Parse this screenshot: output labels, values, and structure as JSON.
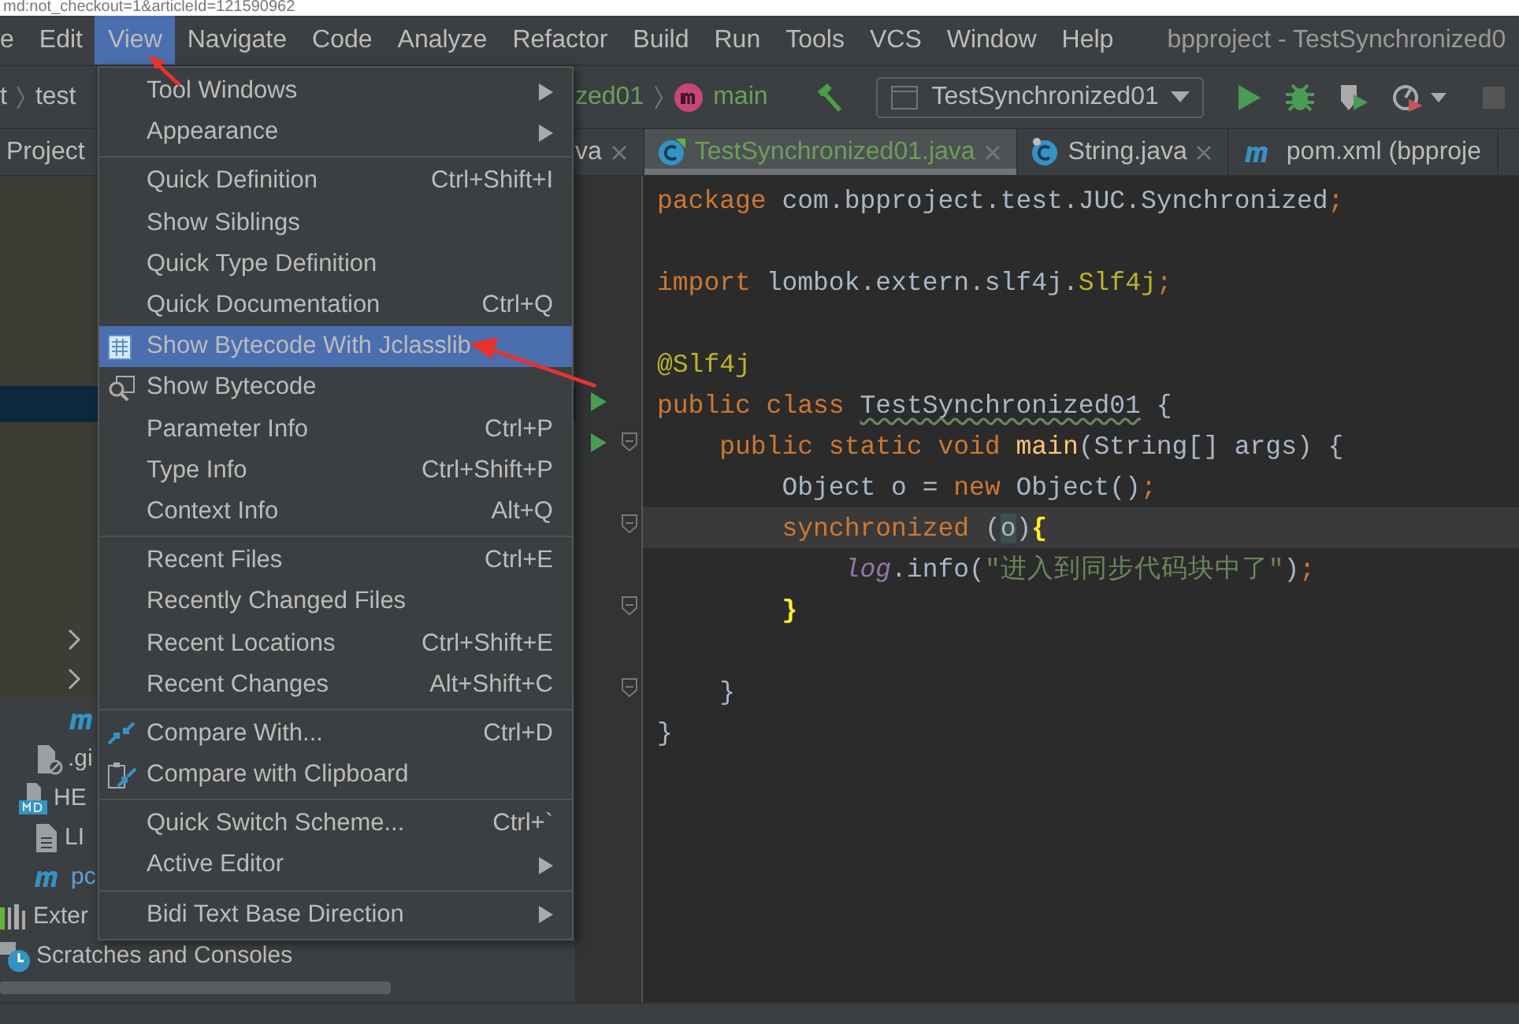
{
  "url_fragment": "md:not_checkout=1&articleId=121590962",
  "menu_bar": {
    "items": [
      {
        "label": "e",
        "selected": false
      },
      {
        "label": "Edit",
        "selected": false
      },
      {
        "label": "View",
        "selected": true
      },
      {
        "label": "Navigate",
        "selected": false
      },
      {
        "label": "Code",
        "selected": false
      },
      {
        "label": "Analyze",
        "selected": false
      },
      {
        "label": "Refactor",
        "selected": false
      },
      {
        "label": "Build",
        "selected": false
      },
      {
        "label": "Run",
        "selected": false
      },
      {
        "label": "Tools",
        "selected": false
      },
      {
        "label": "VCS",
        "selected": false
      },
      {
        "label": "Window",
        "selected": false
      },
      {
        "label": "Help",
        "selected": false
      }
    ],
    "window_title": "bpproject - TestSynchronized0"
  },
  "navigation_bar": {
    "project_crumbs": [
      "t",
      "test"
    ],
    "file_crumbs": [
      {
        "label": "zed01",
        "kind": "class"
      },
      {
        "label": "main",
        "kind": "method"
      }
    ],
    "run_configuration": "TestSynchronized01"
  },
  "project_panel": {
    "title": "Project",
    "tree_top": [
      {
        "kind": "blank",
        "selected": true
      },
      {
        "kind": "folder",
        "expanded": false,
        "selected": false
      },
      {
        "kind": "folder",
        "expanded": false,
        "selected": false
      }
    ],
    "tree_files": [
      {
        "kind": "maven"
      },
      {
        "kind": "ignored",
        "label": ".gi"
      },
      {
        "kind": "markdown",
        "label": "HE"
      },
      {
        "kind": "text",
        "label": "LI"
      },
      {
        "kind": "maven",
        "label": "pc"
      },
      {
        "kind": "library",
        "label": "Exter"
      },
      {
        "kind": "scratches",
        "label": "Scratches and Consoles"
      }
    ]
  },
  "editor_tabs": [
    {
      "label": "va",
      "kind": "plain",
      "selected": false
    },
    {
      "label": "TestSynchronized01.java",
      "kind": "class",
      "selected": true
    },
    {
      "label": "String.java",
      "kind": "locked",
      "selected": false
    },
    {
      "label": "pom.xml (bpproje",
      "kind": "maven",
      "selected": false
    }
  ],
  "code_lines": [
    {
      "current": false,
      "run_marker": false,
      "fold": false,
      "tokens": [
        {
          "kind": "keyword",
          "text": "package "
        },
        {
          "kind": "plain",
          "text": "com.bpproject.test.JUC.Synchronized"
        },
        {
          "kind": "keyword",
          "text": ";"
        }
      ]
    },
    {
      "current": false,
      "run_marker": false,
      "fold": false
    },
    {
      "current": false,
      "run_marker": false,
      "fold": false,
      "tokens": [
        {
          "kind": "keyword",
          "text": "import "
        },
        {
          "kind": "plain",
          "text": "lombok.extern.slf4j."
        },
        {
          "kind": "annotation",
          "text": "Slf4j"
        },
        {
          "kind": "keyword",
          "text": ";"
        }
      ]
    },
    {
      "current": false,
      "run_marker": false,
      "fold": false
    },
    {
      "current": false,
      "run_marker": false,
      "fold": false,
      "tokens": [
        {
          "kind": "annotation",
          "text": "@Slf4j"
        }
      ]
    },
    {
      "current": false,
      "run_marker": true,
      "fold": false,
      "tokens": [
        {
          "kind": "keyword",
          "text": "public class "
        },
        {
          "kind": "typo",
          "text": "TestSynchronized01"
        },
        {
          "kind": "plain",
          "text": " {"
        }
      ]
    },
    {
      "current": false,
      "run_marker": true,
      "fold": true,
      "tokens": [
        {
          "kind": "keyword",
          "text": "    public static void "
        },
        {
          "kind": "method",
          "text": "main"
        },
        {
          "kind": "plain",
          "text": "(String[] args) {"
        }
      ]
    },
    {
      "current": false,
      "run_marker": false,
      "fold": false,
      "tokens": [
        {
          "kind": "plain",
          "text": "        Object o = "
        },
        {
          "kind": "keyword",
          "text": "new "
        },
        {
          "kind": "plain",
          "text": "Object()"
        },
        {
          "kind": "keyword",
          "text": ";"
        }
      ]
    },
    {
      "current": true,
      "run_marker": false,
      "fold": true,
      "tokens": [
        {
          "kind": "keyword",
          "text": "        synchronized "
        },
        {
          "kind": "plain",
          "text": "("
        },
        {
          "kind": "match",
          "text": "o"
        },
        {
          "kind": "plain",
          "text": ")"
        },
        {
          "kind": "brace",
          "text": "{"
        }
      ]
    },
    {
      "current": false,
      "run_marker": false,
      "fold": false,
      "tokens": [
        {
          "kind": "field",
          "text": "            log"
        },
        {
          "kind": "plain",
          "text": ".info("
        },
        {
          "kind": "string",
          "text": "\"进入到同步代码块中了\""
        },
        {
          "kind": "plain",
          "text": ")"
        },
        {
          "kind": "keyword",
          "text": ";"
        }
      ]
    },
    {
      "current": false,
      "run_marker": false,
      "fold": true,
      "tokens": [
        {
          "kind": "brace",
          "text": "        }"
        }
      ]
    },
    {
      "current": false,
      "run_marker": false,
      "fold": false
    },
    {
      "current": false,
      "run_marker": false,
      "fold": true,
      "tokens": [
        {
          "kind": "plain",
          "text": "    }"
        }
      ]
    },
    {
      "current": false,
      "run_marker": false,
      "fold": false,
      "tokens": [
        {
          "kind": "plain",
          "text": "}"
        }
      ]
    }
  ],
  "view_menu": {
    "groups": [
      [
        {
          "label": "Tool Windows",
          "submenu": true,
          "kind": "plain",
          "selected": false
        },
        {
          "label": "Appearance",
          "submenu": true,
          "kind": "plain",
          "selected": false
        }
      ],
      [
        {
          "label": "Quick Definition",
          "shortcut": "Ctrl+Shift+I",
          "submenu": false,
          "kind": "plain",
          "selected": false
        },
        {
          "label": "Show Siblings",
          "submenu": false,
          "kind": "plain",
          "selected": false
        },
        {
          "label": "Quick Type Definition",
          "submenu": false,
          "kind": "plain",
          "selected": false
        },
        {
          "label": "Quick Documentation",
          "shortcut": "Ctrl+Q",
          "submenu": false,
          "kind": "plain",
          "selected": false
        },
        {
          "label": "Show Bytecode With Jclasslib",
          "submenu": false,
          "kind": "grid",
          "selected": true
        },
        {
          "label": "Show Bytecode",
          "submenu": false,
          "kind": "magnifier",
          "selected": false
        },
        {
          "label": "Parameter Info",
          "shortcut": "Ctrl+P",
          "submenu": false,
          "kind": "plain",
          "selected": false
        },
        {
          "label": "Type Info",
          "shortcut": "Ctrl+Shift+P",
          "submenu": false,
          "kind": "plain",
          "selected": false
        },
        {
          "label": "Context Info",
          "shortcut": "Alt+Q",
          "submenu": false,
          "kind": "plain",
          "selected": false
        }
      ],
      [
        {
          "label": "Recent Files",
          "shortcut": "Ctrl+E",
          "submenu": false,
          "kind": "plain",
          "selected": false
        },
        {
          "label": "Recently Changed Files",
          "submenu": false,
          "kind": "plain",
          "selected": false
        },
        {
          "label": "Recent Locations",
          "shortcut": "Ctrl+Shift+E",
          "submenu": false,
          "kind": "plain",
          "selected": false
        },
        {
          "label": "Recent Changes",
          "shortcut": "Alt+Shift+C",
          "submenu": false,
          "kind": "plain",
          "selected": false
        }
      ],
      [
        {
          "label": "Compare With...",
          "shortcut": "Ctrl+D",
          "submenu": false,
          "kind": "compare",
          "selected": false
        },
        {
          "label": "Compare with Clipboard",
          "submenu": false,
          "kind": "clipboard",
          "selected": false
        }
      ],
      [
        {
          "label": "Quick Switch Scheme...",
          "shortcut": "Ctrl+`",
          "submenu": false,
          "kind": "plain",
          "selected": false
        },
        {
          "label": "Active Editor",
          "submenu": true,
          "kind": "plain",
          "selected": false
        }
      ],
      [
        {
          "label": "Bidi Text Base Direction",
          "submenu": true,
          "kind": "plain",
          "selected": false
        }
      ]
    ]
  }
}
